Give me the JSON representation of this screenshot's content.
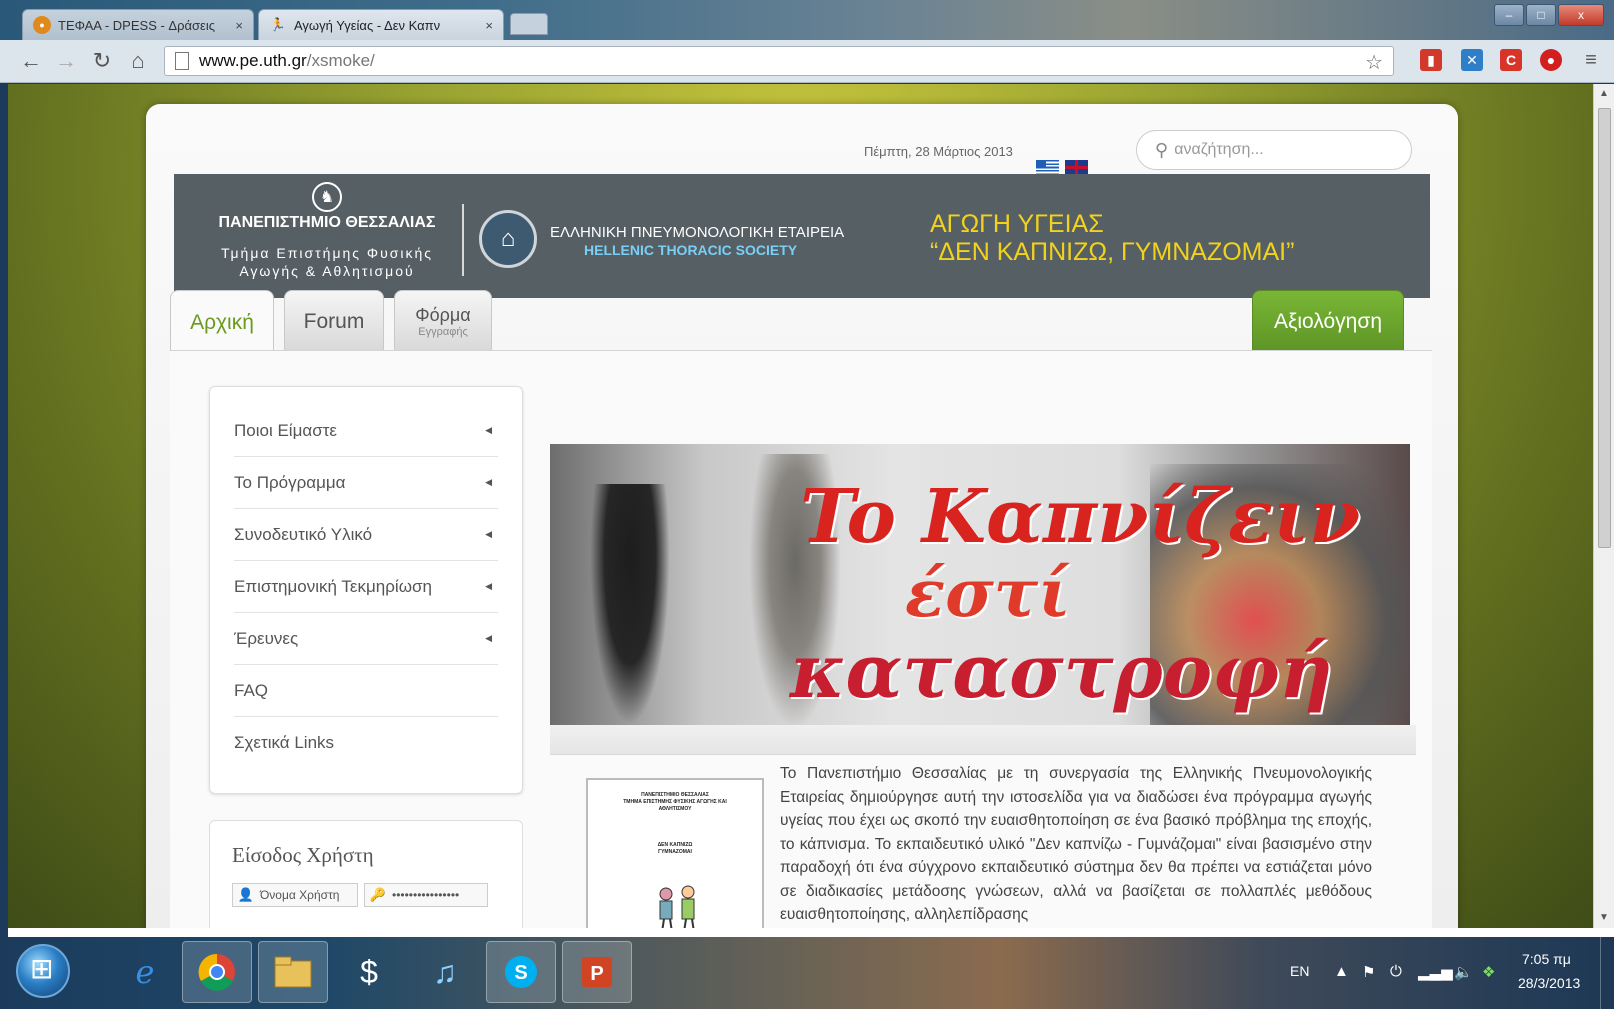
{
  "browser": {
    "tabs": [
      {
        "title": "ΤΕΦΑΑ - DPESS - Δράσεις",
        "favicon": "tefaa-favicon",
        "active": false
      },
      {
        "title": "Αγωγή Υγείας - Δεν Καπν",
        "favicon": "runner-favicon",
        "active": true
      }
    ],
    "close_glyph": "×",
    "url_host": "www.pe.uth.gr",
    "url_path": "/xsmoke/",
    "window_controls": {
      "minimize": "–",
      "maximize": "□",
      "close": "x"
    }
  },
  "site": {
    "date": "Πέμπτη, 28 Μάρτιος 2013",
    "search_placeholder": "αναζήτηση...",
    "banner": {
      "university_name": "ΠΑΝΕΠΙΣΤΗΜΙΟ ΘΕΣΣΑΛΙΑΣ",
      "department_line1": "Τμήμα Επιστήμης Φυσικής",
      "department_line2": "Αγωγής & Αθλητισμού",
      "society_gr": "ΕΛΛΗΝΙΚΗ ΠΝΕΥΜΟΝΟΛΟΓΙΚΗ ΕΤΑΙΡΕΙΑ",
      "society_en": "HELLENIC THORACIC SOCIETY",
      "program_line1": "ΑΓΩΓΗ ΥΓΕΙΑΣ",
      "program_line2": "“ΔΕΝ ΚΑΠΝΙΖΩ, ΓΥΜΝΑΖΟΜΑΙ”"
    },
    "nav": {
      "home": "Αρχική",
      "forum": "Forum",
      "form": "Φόρμα",
      "form_sub": "Εγγραφής",
      "evaluation": "Αξιολόγηση"
    },
    "menu": [
      {
        "label": "Ποιοι Είμαστε",
        "has_submenu": true
      },
      {
        "label": "Το Πρόγραμμα",
        "has_submenu": true
      },
      {
        "label": "Συνοδευτικό Υλικό",
        "has_submenu": true
      },
      {
        "label": "Επιστημονική Τεκμηρίωση",
        "has_submenu": true
      },
      {
        "label": "Έρευνες",
        "has_submenu": true
      },
      {
        "label": "FAQ",
        "has_submenu": false
      },
      {
        "label": "Σχετικά Links",
        "has_submenu": false
      }
    ],
    "login": {
      "title": "Είσοδος Χρήστη",
      "username_placeholder": "Όνομα Χρήστη",
      "password_value": "••••••••••••••••"
    },
    "hero": {
      "line1": "To Καπνίζειν",
      "line2": "έστί",
      "line3": "καταστροφή"
    },
    "doc_thumb": {
      "line1": "ΠΑΝΕΠΙΣΤΗΜΙΟ ΘΕΣΣΑΛΙΑΣ",
      "line2": "ΤΜΗΜΑ ΕΠΙΣΤΗΜΗΣ ΦΥΣΙΚΗΣ ΑΓΩΓΗΣ ΚΑΙ",
      "line3": "ΑΘΛΗΤΙΣΜΟΥ",
      "line4": "ΔΕΝ ΚΑΠΝΙΖΩ",
      "line5": "ΓΥΜΝΑΖΟΜΑΙ"
    },
    "intro": "Το Πανεπιστήμιο Θεσσαλίας με τη συνεργασία της Ελληνικής Πνευμονολογικής Εταιρείας δημιούργησε αυτή την ιστοσελίδα για να διαδώσει ένα πρόγραμμα αγωγής υγείας που έχει ως σκοπό την ευαισθητοποίηση σε ένα βασικό πρόβλημα της εποχής, το κάπνισμα. Το εκπαιδευτικό υλικό \"Δεν καπνίζω - Γυμνάζομαι\" είναι βασισμένο στην παραδοχή ότι ένα σύγχρονο εκπαιδευτικό σύστημα δεν θα πρέπει να εστιάζεται μόνο σε διαδικασίες μετάδοσης γνώσεων, αλλά να βασίζεται σε πολλαπλές μεθόδους ευαισθητοποίησης, αλληλεπίδρασης"
  },
  "taskbar": {
    "language": "EN",
    "time": "7:05 πμ",
    "date": "28/3/2013"
  },
  "colors": {
    "accent_green": "#6b9a1f",
    "banner_bg": "#565f63",
    "program_title": "#f1d21d",
    "society_en": "#7bcff5"
  }
}
